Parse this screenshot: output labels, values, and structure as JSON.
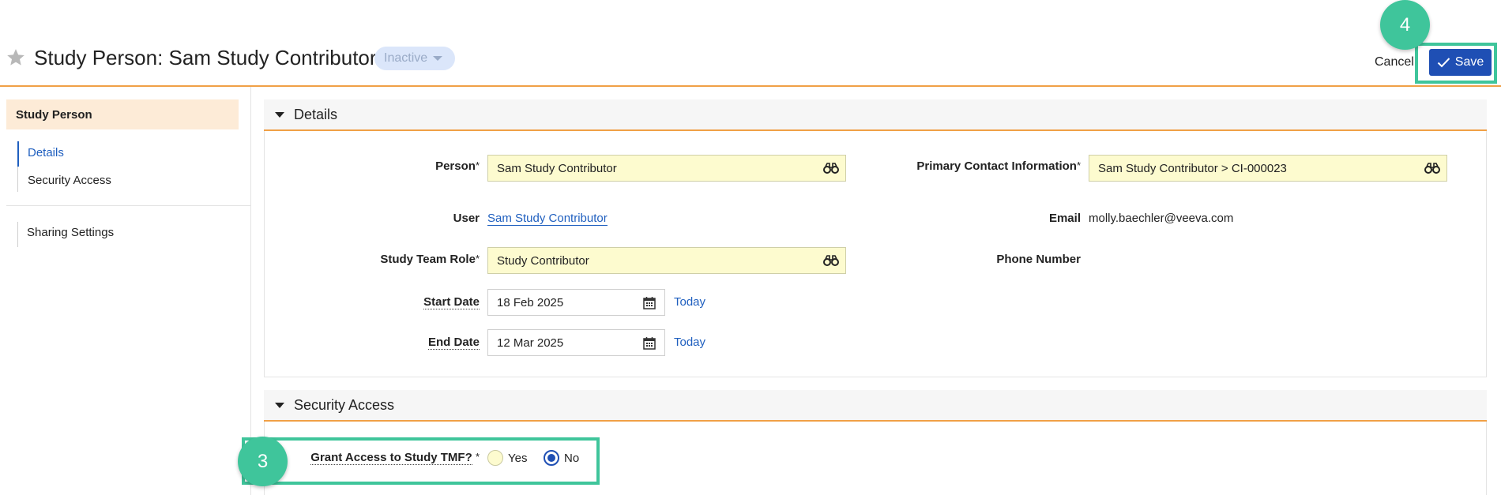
{
  "header": {
    "title": "Study Person: Sam Study Contributor",
    "status": "Inactive",
    "cancel_label": "Cancel",
    "save_label": "Save"
  },
  "annotations": {
    "step_save": "4",
    "step_grant": "3",
    "highlight_color": "#3fc59b"
  },
  "sidebar": {
    "heading": "Study Person",
    "items": [
      {
        "label": "Details",
        "active": true
      },
      {
        "label": "Security Access",
        "active": false
      },
      {
        "label": "Sharing Settings",
        "active": false
      }
    ]
  },
  "details": {
    "section_title": "Details",
    "person": {
      "label": "Person",
      "value": "Sam Study Contributor"
    },
    "user": {
      "label": "User",
      "value": "Sam Study Contributor"
    },
    "study_team_role": {
      "label": "Study Team Role",
      "value": "Study Contributor"
    },
    "start_date": {
      "label": "Start Date",
      "value": "18 Feb 2025",
      "today": "Today"
    },
    "end_date": {
      "label": "End Date",
      "value": "12 Mar 2025",
      "today": "Today"
    },
    "primary_contact": {
      "label": "Primary Contact Information",
      "value": "Sam Study Contributor > CI-000023"
    },
    "email": {
      "label": "Email",
      "value": "molly.baechler@veeva.com"
    },
    "phone": {
      "label": "Phone Number",
      "value": ""
    },
    "required_mark": "*"
  },
  "security_access": {
    "section_title": "Security Access",
    "grant_label": "Grant Access to Study TMF?",
    "required_mark": "*",
    "options": [
      {
        "label": "Yes",
        "selected": false
      },
      {
        "label": "No",
        "selected": true
      }
    ]
  },
  "colors": {
    "accent_blue": "#1f4fb4",
    "link_blue": "#1f5fbf",
    "orange": "#f0a046",
    "lookup_yellow": "#fdfbcf"
  }
}
